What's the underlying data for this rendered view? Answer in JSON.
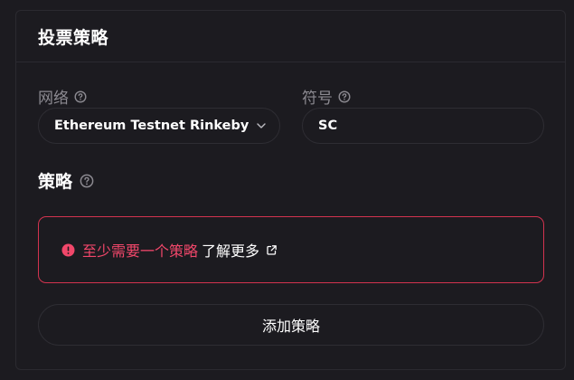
{
  "panel": {
    "title": "投票策略"
  },
  "network": {
    "label": "网络",
    "value": "Ethereum Testnet Rinkeby"
  },
  "symbol": {
    "label": "符号",
    "value": "SC"
  },
  "strategies": {
    "title": "策略",
    "error_text": "至少需要一个策略",
    "learn_more": "了解更多",
    "add_button": "添加策略"
  },
  "icons": {
    "help": "help-circle-icon",
    "chevron": "chevron-down-icon",
    "error": "alert-circle-icon",
    "external": "external-link-icon"
  },
  "colors": {
    "background": "#1c1b20",
    "border": "#2b2a30",
    "muted_text": "#8c8a91",
    "error": "#f1476a"
  }
}
